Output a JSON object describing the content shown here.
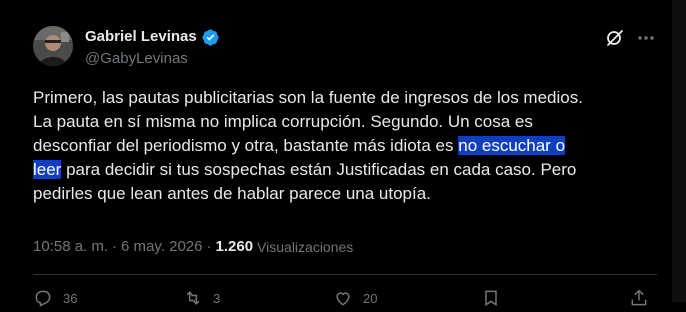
{
  "author": {
    "display_name": "Gabriel Levinas",
    "handle": "@GabyLevinas"
  },
  "tweet": {
    "text_before": "Primero, las pautas publicitarias son la fuente de ingresos de los medios.\nLa pauta en sí misma no implica corrupción. Segundo. Un cosa es\ndesconfiar del periodismo y otra, bastante más idiota es ",
    "text_highlight_1": "no escuchar o",
    "text_middle": "\n",
    "text_highlight_2": "leer",
    "text_after": " para decidir si tus sospechas están Justificadas en cada caso. Pero\npedirles que lean antes de hablar parece una utopía.",
    "time": "10:58 a. m.",
    "separator": "·",
    "date": "6 may. 2026",
    "views_count": "1.260",
    "views_label": "Visualizaciones"
  },
  "actions": {
    "replies": "36",
    "reposts": "3",
    "likes": "20"
  },
  "colors": {
    "background": "#000000",
    "text_primary": "#e7e9ea",
    "text_secondary": "#71767b",
    "verified": "#1d9bf0",
    "selection": "#0f3fbf"
  },
  "icons": {
    "verified": "verified-badge-icon",
    "grok": "grok-icon",
    "more": "more-icon",
    "reply": "reply-icon",
    "repost": "repost-icon",
    "like": "like-icon",
    "bookmark": "bookmark-icon",
    "share": "share-icon"
  }
}
